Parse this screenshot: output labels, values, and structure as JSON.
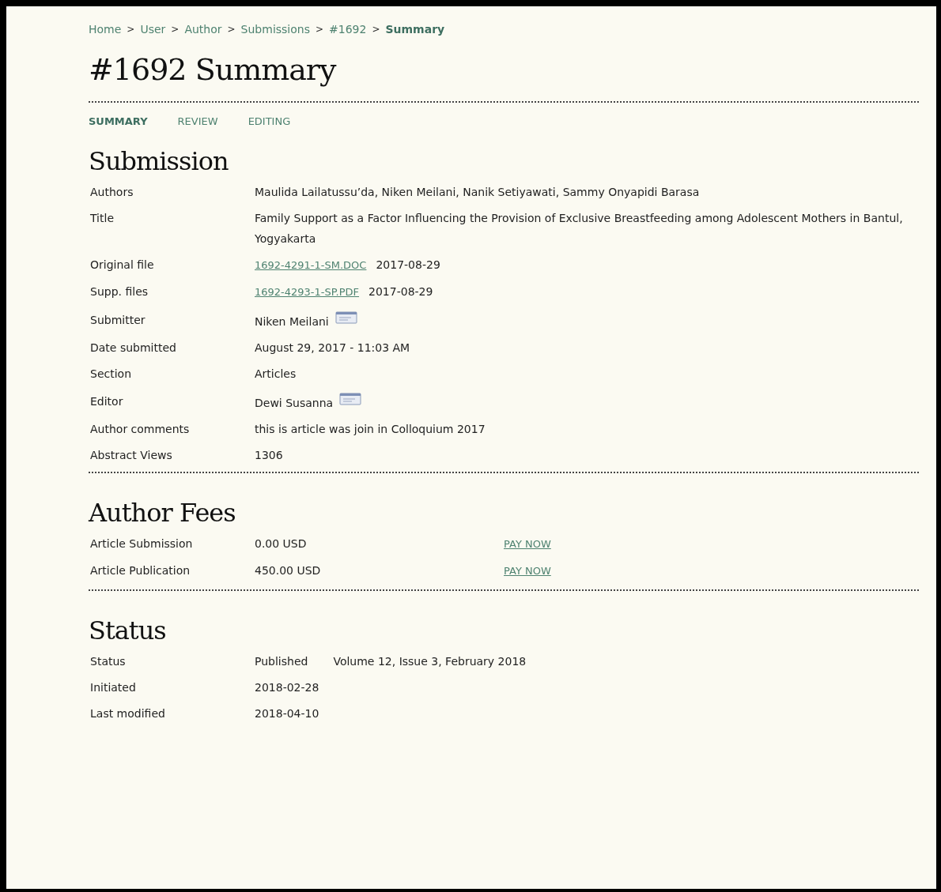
{
  "breadcrumb": [
    {
      "label": "Home",
      "current": false
    },
    {
      "label": "User",
      "current": false
    },
    {
      "label": "Author",
      "current": false
    },
    {
      "label": "Submissions",
      "current": false
    },
    {
      "label": "#1692",
      "current": false
    },
    {
      "label": "Summary",
      "current": true
    }
  ],
  "breadcrumb_separator": ">",
  "page_title": "#1692 Summary",
  "tabs": [
    {
      "label": "SUMMARY",
      "selected": true
    },
    {
      "label": "REVIEW",
      "selected": false
    },
    {
      "label": "EDITING",
      "selected": false
    }
  ],
  "submission": {
    "heading": "Submission",
    "rows": [
      {
        "kind": "text",
        "label": "Authors",
        "value": "Maulida Lailatussu’da, Niken Meilani, Nanik Setiyawati, Sammy Onyapidi Barasa"
      },
      {
        "kind": "text",
        "label": "Title",
        "value": "Family Support as a Factor Influencing the Provision of Exclusive Breastfeeding among Adolescent Mothers in Bantul, Yogyakarta"
      },
      {
        "kind": "file",
        "label": "Original file",
        "file": "1692-4291-1-SM.DOC",
        "value": "2017-08-29"
      },
      {
        "kind": "supp_file",
        "label": "Supp. files",
        "file": "1692-4293-1-SP.PDF",
        "value": "2017-08-29"
      },
      {
        "kind": "person",
        "label": "Submitter",
        "value": "Niken Meilani"
      },
      {
        "kind": "date",
        "label": "Date submitted",
        "value": "August 29, 2017 - 11:03 AM"
      },
      {
        "kind": "text",
        "label": "Section",
        "value": "Articles"
      },
      {
        "kind": "person",
        "label": "Editor",
        "value": "Dewi Susanna"
      },
      {
        "kind": "text",
        "label": "Author comments",
        "value": "this is article was join in Colloquium 2017"
      },
      {
        "kind": "text",
        "label": "Abstract Views",
        "value": "1306"
      }
    ]
  },
  "author_fees": {
    "heading": "Author Fees",
    "rows": [
      {
        "label": "Article Submission",
        "amount": "0.00 USD",
        "action": "PAY NOW"
      },
      {
        "label": "Article Publication",
        "amount": "450.00 USD",
        "action": "PAY NOW"
      }
    ]
  },
  "status": {
    "heading": "Status",
    "rows": [
      {
        "label": "Status",
        "value": "Published",
        "extra": "Volume 12, Issue 3, February 2018"
      },
      {
        "label": "Initiated",
        "value": "2018-02-28"
      },
      {
        "label": "Last modified",
        "value": "2018-04-10"
      }
    ]
  }
}
